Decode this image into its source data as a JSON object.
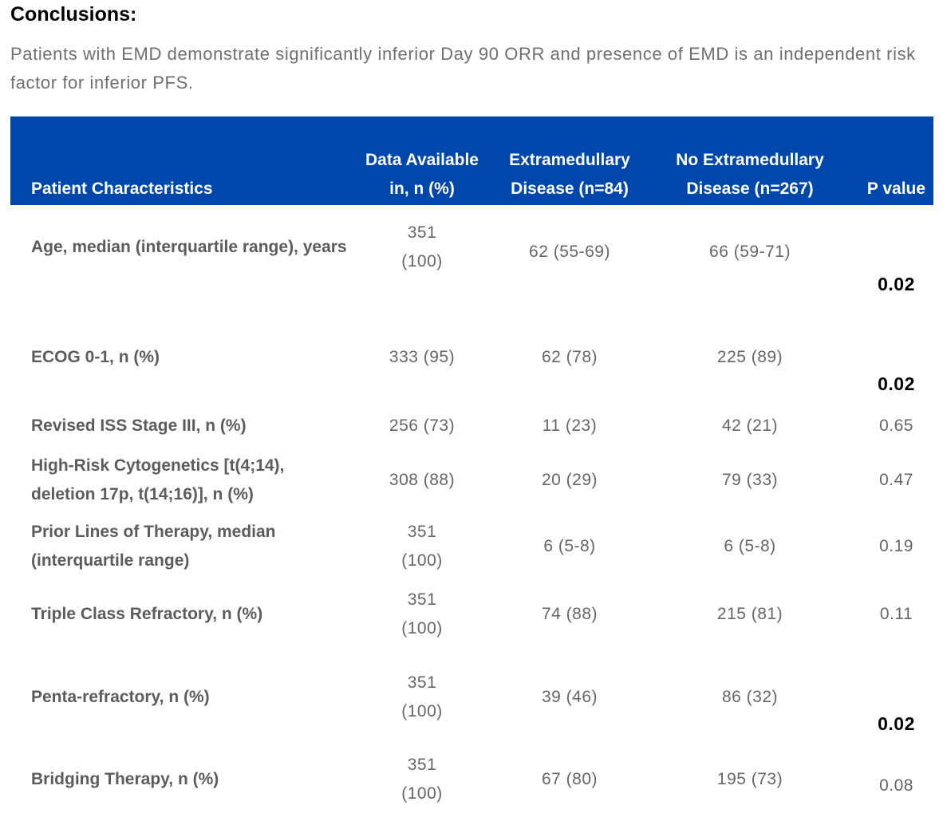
{
  "conclusions": {
    "heading": "Conclusions:",
    "text": "Patients with EMD demonstrate significantly inferior Day 90 ORR and presence of EMD is an independent risk factor for inferior PFS."
  },
  "table": {
    "header_bg_color": "#0047ab",
    "headers": {
      "characteristic": "Patient Characteristics",
      "available": "Data Available in, n (%)",
      "emd": "Extramedullary Disease (n=84)",
      "no_emd": "No Extramedullary Disease (n=267)",
      "p_value": "P value"
    },
    "rows": [
      {
        "characteristic": "Age, median (interquartile range), years",
        "available": "351 (100)",
        "emd": "62 (55-69)",
        "no_emd": "66 (59-71)",
        "p_value": "0.02",
        "significant": true
      },
      {
        "characteristic": "ECOG 0-1, n (%)",
        "available": "333 (95)",
        "emd": "62 (78)",
        "no_emd": "225 (89)",
        "p_value": "0.02",
        "significant": true
      },
      {
        "characteristic": "Revised ISS Stage III, n (%)",
        "available": "256 (73)",
        "emd": "11 (23)",
        "no_emd": "42 (21)",
        "p_value": "0.65",
        "significant": false
      },
      {
        "characteristic": "High-Risk Cytogenetics [t(4;14), deletion 17p, t(14;16)], n (%)",
        "available": "308 (88)",
        "emd": "20 (29)",
        "no_emd": "79 (33)",
        "p_value": "0.47",
        "significant": false
      },
      {
        "characteristic": "Prior Lines of Therapy, median (interquartile range)",
        "available": "351 (100)",
        "emd": "6 (5-8)",
        "no_emd": "6 (5-8)",
        "p_value": "0.19",
        "significant": false
      },
      {
        "characteristic": "Triple Class Refractory, n (%)",
        "available": "351 (100)",
        "emd": "74 (88)",
        "no_emd": "215 (81)",
        "p_value": "0.11",
        "significant": false
      },
      {
        "characteristic": "Penta-refractory, n (%)",
        "available": "351 (100)",
        "emd": "39 (46)",
        "no_emd": "86 (32)",
        "p_value": "0.02",
        "significant": true
      },
      {
        "characteristic": "Bridging Therapy, n (%)",
        "available": "351 (100)",
        "emd": "67 (80)",
        "no_emd": "195 (73)",
        "p_value": "0.08",
        "significant": false
      }
    ]
  }
}
